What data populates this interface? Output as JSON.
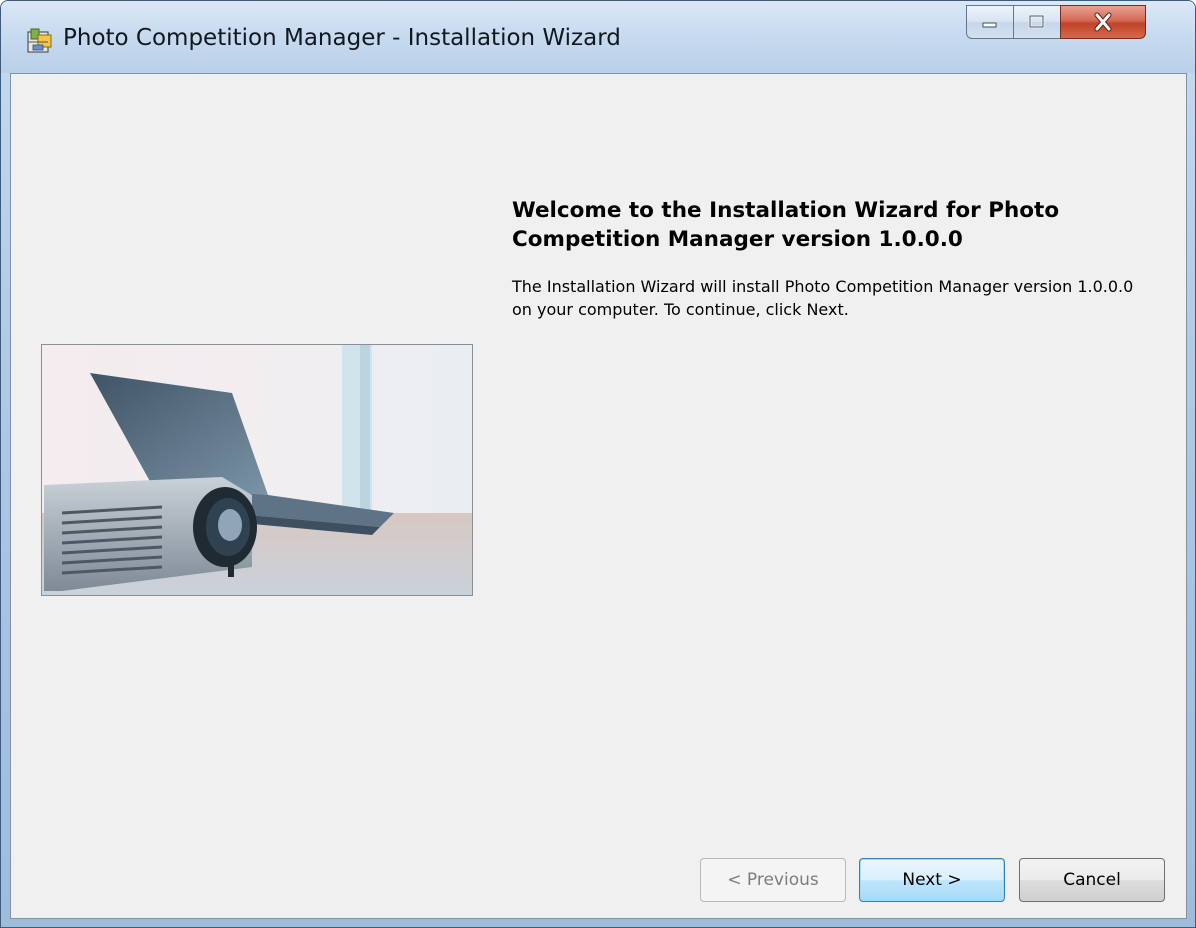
{
  "window": {
    "title": "Photo Competition Manager - Installation Wizard"
  },
  "caption_buttons": {
    "minimize_icon": "minimize-icon",
    "maximize_icon": "maximize-icon",
    "close_icon": "close-icon"
  },
  "welcome": {
    "heading": "Welcome to the Installation Wizard for Photo Competition Manager version 1.0.0.0",
    "description": "The Installation Wizard will install Photo Competition Manager version 1.0.0.0 on your computer. To continue, click Next."
  },
  "hero_image": {
    "subject": "laptop and projector photo"
  },
  "buttons": {
    "previous_label": "< Previous",
    "previous_enabled": false,
    "next_label": "Next >",
    "cancel_label": "Cancel"
  },
  "colors": {
    "titlebar": "#c8dbef",
    "client_background": "#f0f0f0",
    "close_button": "#c1432a",
    "default_button_border": "#3c7fb1"
  }
}
